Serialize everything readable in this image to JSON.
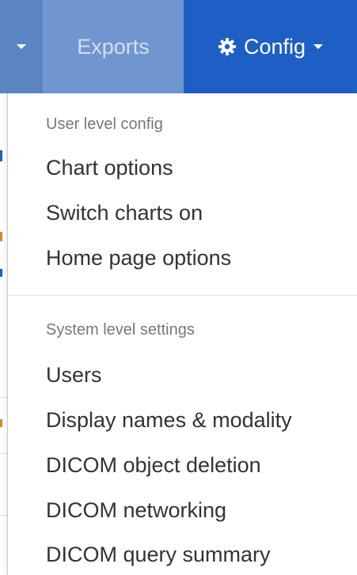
{
  "navbar": {
    "exports_label": "Exports",
    "config_label": "Config",
    "colors": {
      "left_bg": "#5b84c2",
      "exports_bg": "#7196cf",
      "config_bg": "#1d5fc4"
    }
  },
  "menu": {
    "user_section": {
      "header": "User level config",
      "items": [
        "Chart options",
        "Switch charts on",
        "Home page options"
      ]
    },
    "system_section": {
      "header": "System level settings",
      "items": [
        "Users",
        "Display names & modality",
        "DICOM object deletion",
        "DICOM networking",
        "DICOM query summary"
      ]
    }
  }
}
